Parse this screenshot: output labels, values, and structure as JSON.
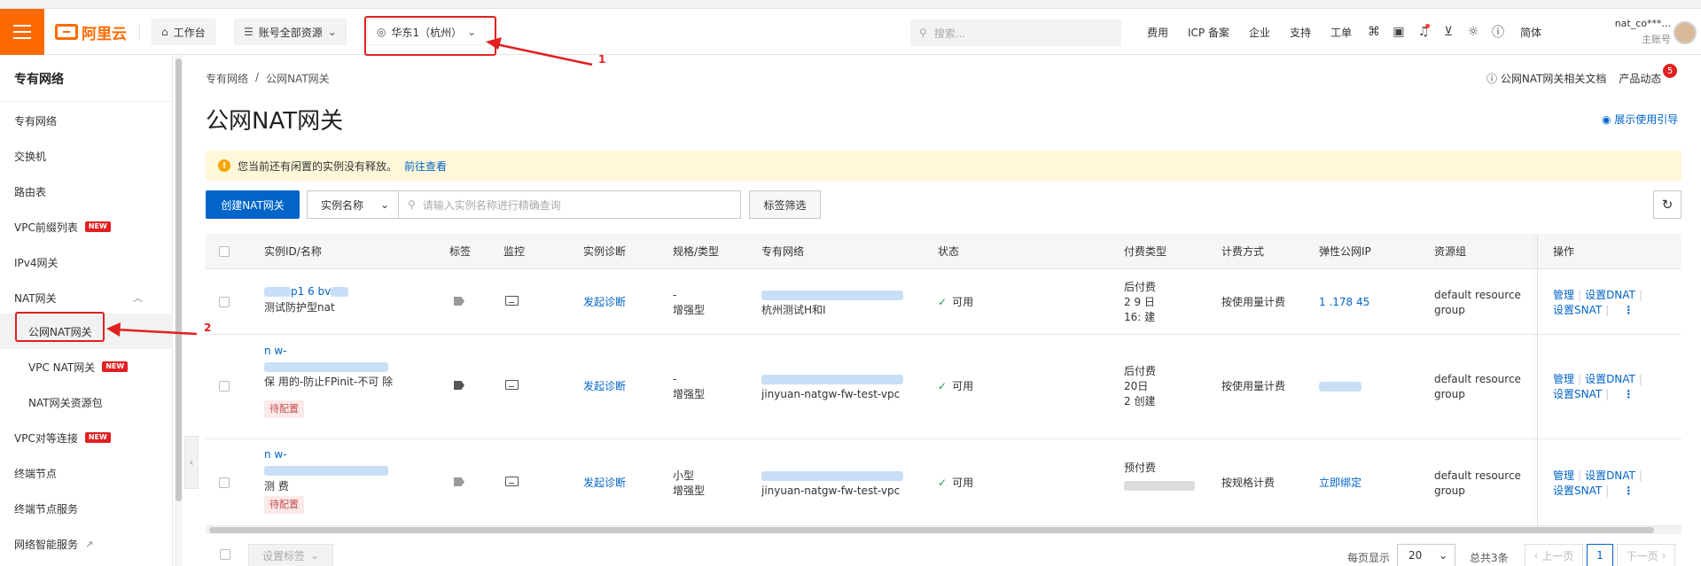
{
  "header": {
    "logo_text": "阿里云",
    "workbench": "工作台",
    "account_resources": "账号全部资源",
    "region": "华东1（杭州）",
    "search_placeholder": "搜索...",
    "links": [
      "费用",
      "ICP 备案",
      "企业",
      "支持",
      "工单"
    ],
    "lang": "简体",
    "account_name": "nat_co***...",
    "account_role": "主账号"
  },
  "sidebar": {
    "title": "专有网络",
    "items": [
      {
        "label": "专有网络"
      },
      {
        "label": "交换机"
      },
      {
        "label": "路由表"
      },
      {
        "label": "VPC前缀列表",
        "badge": "NEW"
      },
      {
        "label": "IPv4网关"
      },
      {
        "label": "NAT网关"
      },
      {
        "label": "公网NAT网关"
      },
      {
        "label": "VPC NAT网关",
        "badge": "NEW"
      },
      {
        "label": "NAT网关资源包"
      },
      {
        "label": "VPC对等连接",
        "badge": "NEW"
      },
      {
        "label": "终端节点"
      },
      {
        "label": "终端节点服务"
      },
      {
        "label": "网络智能服务"
      }
    ]
  },
  "main": {
    "breadcrumb": [
      "专有网络",
      "/",
      "公网NAT网关"
    ],
    "title": "公网NAT网关",
    "doc_link": "公网NAT网关相关文档",
    "product_news": "产品动态",
    "news_count": "5",
    "usage_guide": "展示使用引导",
    "notice_text": "您当前还有闲置的实例没有释放。",
    "notice_link": "前往查看",
    "create_button": "创建NAT网关",
    "filter_field": "实例名称",
    "filter_placeholder": "请输入实例名称进行精确查询",
    "tag_filter": "标签筛选"
  },
  "table": {
    "columns": [
      "实例ID/名称",
      "标签",
      "监控",
      "实例诊断",
      "规格/类型",
      "专有网络",
      "状态",
      "付费类型",
      "计费方式",
      "弹性公网IP",
      "资源组",
      "操作"
    ],
    "rows": [
      {
        "id_line1": "p1   6   bv",
        "name": "测试防护型nat",
        "diag": "发起诊断",
        "spec1": "-",
        "spec2": "增强型",
        "vpc_name": "杭州测试H和I",
        "status": "可用",
        "pay_type": "后付费",
        "pay_line2": "2   9   日",
        "pay_line3": "16:   建",
        "billing": "按使用量计费",
        "eip": "1   .178   45",
        "rg1": "default resource",
        "rg2": "group",
        "op_manage": "管理",
        "op_dnat": "设置DNAT",
        "op_snat": "设置SNAT"
      },
      {
        "id_line1": "n   w-",
        "name": "保   用的-防止FPinit-不可   除",
        "tag": "待配置",
        "diag": "发起诊断",
        "spec1": "-",
        "spec2": "增强型",
        "vpc_name": "jinyuan-natgw-fw-test-vpc",
        "status": "可用",
        "pay_type": "后付费",
        "pay_line2": "   20日",
        "pay_line3": "2   创建",
        "billing": "按使用量计费",
        "eip": "",
        "rg1": "default resource",
        "rg2": "group",
        "op_manage": "管理",
        "op_dnat": "设置DNAT",
        "op_snat": "设置SNAT"
      },
      {
        "id_line1": "n   w-",
        "name": "测   费",
        "tag": "待配置",
        "diag": "发起诊断",
        "spec1": "小型",
        "spec2": "增强型",
        "vpc_name": "jinyuan-natgw-fw-test-vpc",
        "status": "可用",
        "pay_type": "预付费",
        "pay_line2": "",
        "pay_line3": "",
        "billing": "按规格计费",
        "eip": "立即绑定",
        "rg1": "default resource",
        "rg2": "group",
        "op_manage": "管理",
        "op_dnat": "设置DNAT",
        "op_snat": "设置SNAT"
      }
    ]
  },
  "footer": {
    "batch_tag": "设置标签",
    "per_page_label": "每页显示",
    "page_size": "20",
    "total": "总共3条",
    "prev": "上一页",
    "current": "1",
    "next": "下一页"
  },
  "annotations": {
    "one": "1",
    "two": "2"
  },
  "colors": {
    "brand": "#ff6a00",
    "primary": "#0064c8",
    "annotation": "#e02020",
    "notice_bg": "#fff7d9"
  }
}
